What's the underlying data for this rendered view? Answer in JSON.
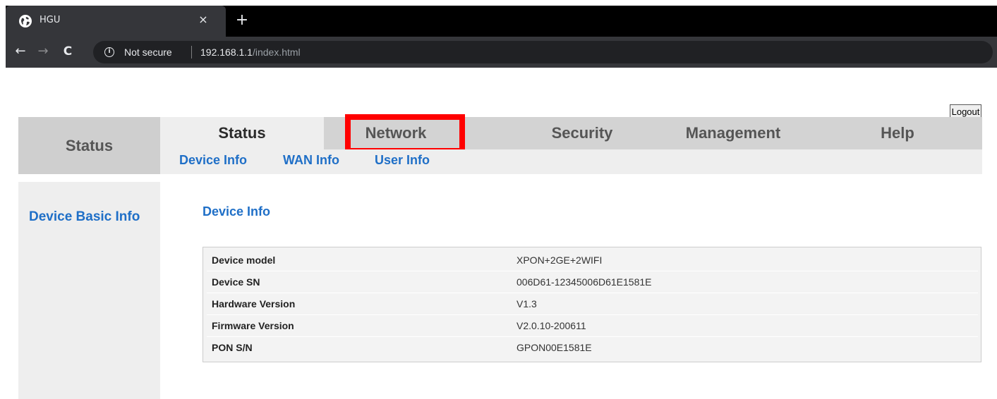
{
  "browser": {
    "tab_title": "HGU",
    "tab_close": "×",
    "new_tab": "+",
    "back": "←",
    "forward": "→",
    "reload": "C",
    "security_label": "Not secure",
    "url_host": "192.168.1.1",
    "url_path": "/index.html"
  },
  "header": {
    "logout_label": "Logout",
    "brand": "Status"
  },
  "menu": {
    "tabs": [
      {
        "label": "Status"
      },
      {
        "label": "Network"
      },
      {
        "label": "Security"
      },
      {
        "label": "Management"
      },
      {
        "label": "Help"
      }
    ],
    "active": "Status",
    "highlighted": "Network",
    "highlight_color": "#ff0000"
  },
  "submenu": {
    "items": [
      {
        "label": "Device Info"
      },
      {
        "label": "WAN Info"
      },
      {
        "label": "User Info"
      }
    ]
  },
  "sidebar": {
    "items": [
      {
        "label": "Device Basic Info"
      }
    ]
  },
  "main": {
    "section_title": "Device Info",
    "rows": [
      {
        "label": "Device model",
        "value": "XPON+2GE+2WIFI"
      },
      {
        "label": "Device SN",
        "value": "006D61-12345006D61E1581E"
      },
      {
        "label": "Hardware Version",
        "value": "V1.3"
      },
      {
        "label": "Firmware Version",
        "value": "V2.0.10-200611"
      },
      {
        "label": "PON S/N",
        "value": "GPON00E1581E"
      }
    ]
  },
  "colors": {
    "link_blue": "#1f6fc7",
    "menu_gray": "#d3d3d3",
    "panel_gray": "#eeeeee"
  }
}
